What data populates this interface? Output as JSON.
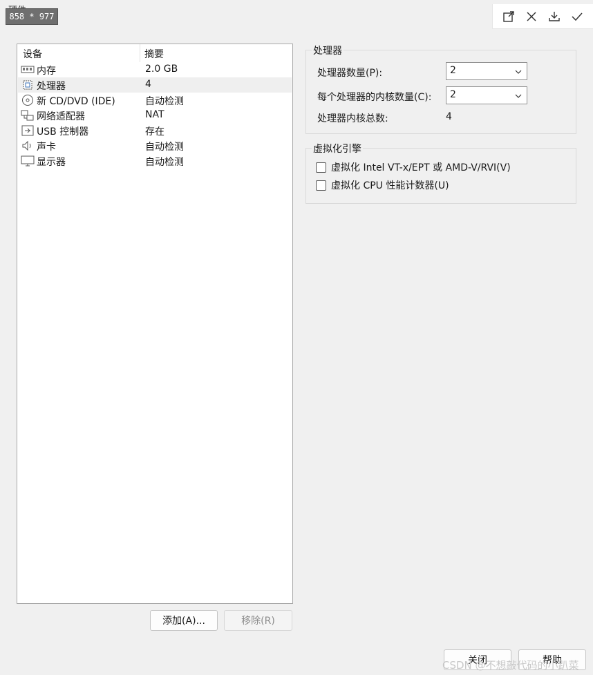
{
  "window": {
    "title": "硬件",
    "size_badge": "858 * 977"
  },
  "toolbar": {
    "items": [
      {
        "name": "maximize-icon"
      },
      {
        "name": "close-icon"
      },
      {
        "name": "download-icon"
      },
      {
        "name": "check-icon"
      }
    ]
  },
  "device_list": {
    "headers": {
      "device": "设备",
      "summary": "摘要"
    },
    "rows": [
      {
        "icon": "memory-icon",
        "name": "内存",
        "summary": "2.0 GB",
        "selected": false
      },
      {
        "icon": "processor-icon",
        "name": "处理器",
        "summary": "4",
        "selected": true
      },
      {
        "icon": "cd-dvd-icon",
        "name": "新 CD/DVD (IDE)",
        "summary": "自动检测",
        "selected": false
      },
      {
        "icon": "network-adapter-icon",
        "name": "网络适配器",
        "summary": "NAT",
        "selected": false
      },
      {
        "icon": "usb-icon",
        "name": "USB 控制器",
        "summary": "存在",
        "selected": false
      },
      {
        "icon": "sound-card-icon",
        "name": "声卡",
        "summary": "自动检测",
        "selected": false
      },
      {
        "icon": "display-icon",
        "name": "显示器",
        "summary": "自动检测",
        "selected": false
      }
    ],
    "add_label": "添加(A)...",
    "remove_label": "移除(R)"
  },
  "processor_group": {
    "title": "处理器",
    "count_label": "处理器数量(P):",
    "count_value": "2",
    "cores_label": "每个处理器的内核数量(C):",
    "cores_value": "2",
    "total_label": "处理器内核总数:",
    "total_value": "4"
  },
  "virtualization_group": {
    "title": "虚拟化引擎",
    "option_vtx": "虚拟化 Intel VT-x/EPT 或 AMD-V/RVI(V)",
    "option_vtx_checked": false,
    "option_cpu_counters": "虚拟化 CPU 性能计数器(U)",
    "option_cpu_counters_checked": false
  },
  "footer": {
    "close_label": "关闭",
    "help_label": "帮助"
  },
  "watermark": "CSDN @不想敲代码的小趴菜"
}
